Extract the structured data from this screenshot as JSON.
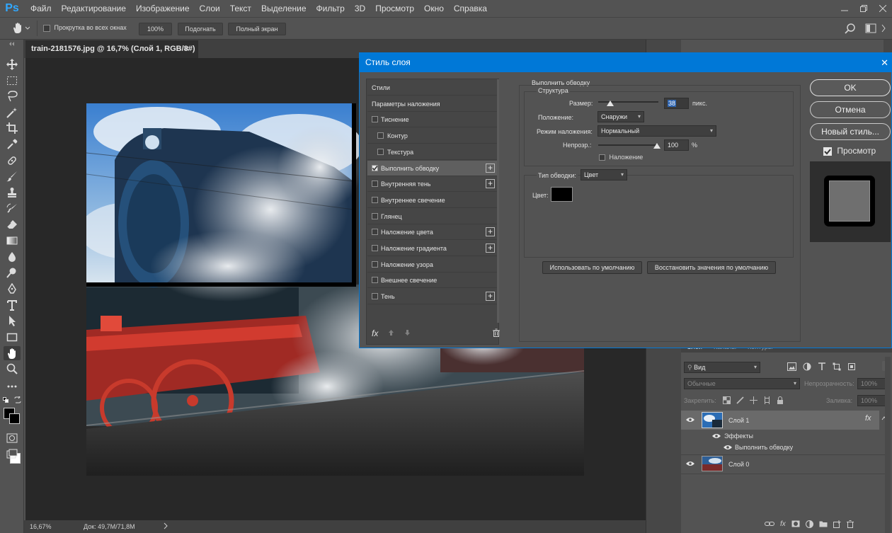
{
  "app": {
    "logo": "Ps"
  },
  "menu": [
    "Файл",
    "Редактирование",
    "Изображение",
    "Слои",
    "Текст",
    "Выделение",
    "Фильтр",
    "3D",
    "Просмотр",
    "Окно",
    "Справка"
  ],
  "options": {
    "scroll_all": "Прокрутка во всех окнах",
    "zoom_100": "100%",
    "fit": "Подогнать",
    "fullscreen": "Полный экран"
  },
  "document": {
    "tab_title": "train-2181576.jpg @ 16,7% (Слой 1, RGB/8#) *",
    "close": "×",
    "zoom": "16,67%",
    "doc_info": "Док: 49,7M/71,8M"
  },
  "dialog": {
    "title": "Стиль слоя",
    "close": "✕",
    "styles": [
      {
        "label": "Стили",
        "checkbox": false,
        "plus": false,
        "indent": false,
        "active": false
      },
      {
        "label": "Параметры наложения",
        "checkbox": false,
        "plus": false,
        "indent": false,
        "active": false
      },
      {
        "label": "Тиснение",
        "checkbox": true,
        "checked": false,
        "plus": false,
        "indent": false,
        "active": false
      },
      {
        "label": "Контур",
        "checkbox": true,
        "checked": false,
        "plus": false,
        "indent": true,
        "active": false
      },
      {
        "label": "Текстура",
        "checkbox": true,
        "checked": false,
        "plus": false,
        "indent": true,
        "active": false
      },
      {
        "label": "Выполнить обводку",
        "checkbox": true,
        "checked": true,
        "plus": true,
        "indent": false,
        "active": true
      },
      {
        "label": "Внутренняя тень",
        "checkbox": true,
        "checked": false,
        "plus": true,
        "indent": false,
        "active": false
      },
      {
        "label": "Внутреннее свечение",
        "checkbox": true,
        "checked": false,
        "plus": false,
        "indent": false,
        "active": false
      },
      {
        "label": "Глянец",
        "checkbox": true,
        "checked": false,
        "plus": false,
        "indent": false,
        "active": false
      },
      {
        "label": "Наложение цвета",
        "checkbox": true,
        "checked": false,
        "plus": true,
        "indent": false,
        "active": false
      },
      {
        "label": "Наложение градиента",
        "checkbox": true,
        "checked": false,
        "plus": true,
        "indent": false,
        "active": false
      },
      {
        "label": "Наложение узора",
        "checkbox": true,
        "checked": false,
        "plus": false,
        "indent": false,
        "active": false
      },
      {
        "label": "Внешнее свечение",
        "checkbox": true,
        "checked": false,
        "plus": false,
        "indent": false,
        "active": false
      },
      {
        "label": "Тень",
        "checkbox": true,
        "checked": false,
        "plus": true,
        "indent": false,
        "active": false
      }
    ],
    "fx_label": "fx",
    "stroke": {
      "section_title": "Выполнить обводку",
      "structure_title": "Структура",
      "size_label": "Размер:",
      "size_value": "38",
      "size_unit": "пикс.",
      "position_label": "Положение:",
      "position_value": "Снаружи",
      "blend_label": "Режим наложения:",
      "blend_value": "Нормальный",
      "opacity_label": "Непрозр.:",
      "opacity_value": "100",
      "opacity_unit": "%",
      "overprint_label": "Наложение",
      "fill_type_label": "Тип обводки:",
      "fill_type_value": "Цвет",
      "color_label": "Цвет:",
      "color_value": "#000000",
      "make_default": "Использовать по умолчанию",
      "reset_default": "Восстановить значения по умолчанию"
    },
    "buttons": {
      "ok": "OK",
      "cancel": "Отмена",
      "new_style": "Новый стиль...",
      "preview": "Просмотр"
    }
  },
  "layers_panel": {
    "tabs": [
      "Слои",
      "Каналы",
      "Контуры"
    ],
    "kind_filter": "Вид",
    "blend_mode": "Обычные",
    "opacity_label": "Непрозрачность:",
    "opacity_value": "100%",
    "lock_label": "Закрепить:",
    "fill_label": "Заливка:",
    "fill_value": "100%",
    "layers": [
      {
        "name": "Слой 1",
        "selected": true,
        "fx": "fx"
      },
      {
        "name": "Слой 0",
        "selected": false
      }
    ],
    "effects_label": "Эффекты",
    "effect_item": "Выполнить обводку"
  }
}
